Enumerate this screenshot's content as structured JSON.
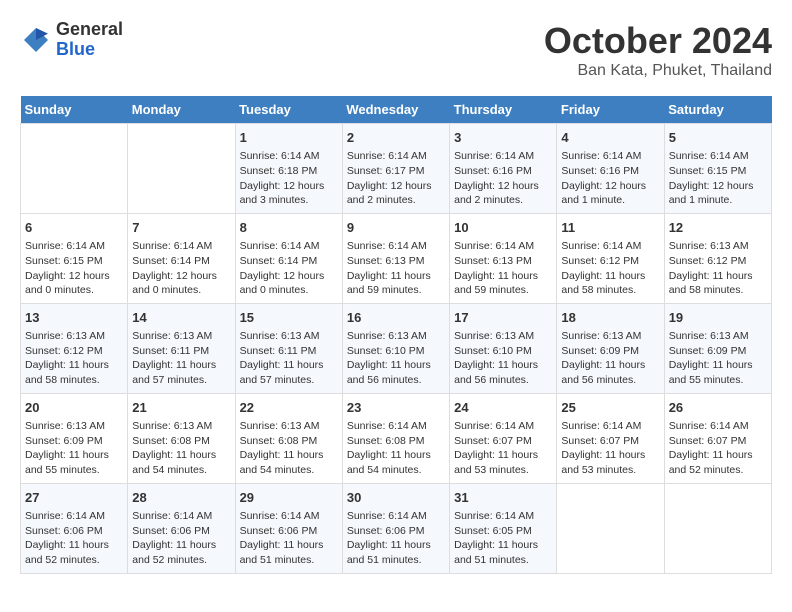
{
  "header": {
    "logo_general": "General",
    "logo_blue": "Blue",
    "title": "October 2024",
    "subtitle": "Ban Kata, Phuket, Thailand"
  },
  "weekdays": [
    "Sunday",
    "Monday",
    "Tuesday",
    "Wednesday",
    "Thursday",
    "Friday",
    "Saturday"
  ],
  "weeks": [
    [
      {
        "day": "",
        "info": ""
      },
      {
        "day": "",
        "info": ""
      },
      {
        "day": "1",
        "info": "Sunrise: 6:14 AM\nSunset: 6:18 PM\nDaylight: 12 hours and 3 minutes."
      },
      {
        "day": "2",
        "info": "Sunrise: 6:14 AM\nSunset: 6:17 PM\nDaylight: 12 hours and 2 minutes."
      },
      {
        "day": "3",
        "info": "Sunrise: 6:14 AM\nSunset: 6:16 PM\nDaylight: 12 hours and 2 minutes."
      },
      {
        "day": "4",
        "info": "Sunrise: 6:14 AM\nSunset: 6:16 PM\nDaylight: 12 hours and 1 minute."
      },
      {
        "day": "5",
        "info": "Sunrise: 6:14 AM\nSunset: 6:15 PM\nDaylight: 12 hours and 1 minute."
      }
    ],
    [
      {
        "day": "6",
        "info": "Sunrise: 6:14 AM\nSunset: 6:15 PM\nDaylight: 12 hours and 0 minutes."
      },
      {
        "day": "7",
        "info": "Sunrise: 6:14 AM\nSunset: 6:14 PM\nDaylight: 12 hours and 0 minutes."
      },
      {
        "day": "8",
        "info": "Sunrise: 6:14 AM\nSunset: 6:14 PM\nDaylight: 12 hours and 0 minutes."
      },
      {
        "day": "9",
        "info": "Sunrise: 6:14 AM\nSunset: 6:13 PM\nDaylight: 11 hours and 59 minutes."
      },
      {
        "day": "10",
        "info": "Sunrise: 6:14 AM\nSunset: 6:13 PM\nDaylight: 11 hours and 59 minutes."
      },
      {
        "day": "11",
        "info": "Sunrise: 6:14 AM\nSunset: 6:12 PM\nDaylight: 11 hours and 58 minutes."
      },
      {
        "day": "12",
        "info": "Sunrise: 6:13 AM\nSunset: 6:12 PM\nDaylight: 11 hours and 58 minutes."
      }
    ],
    [
      {
        "day": "13",
        "info": "Sunrise: 6:13 AM\nSunset: 6:12 PM\nDaylight: 11 hours and 58 minutes."
      },
      {
        "day": "14",
        "info": "Sunrise: 6:13 AM\nSunset: 6:11 PM\nDaylight: 11 hours and 57 minutes."
      },
      {
        "day": "15",
        "info": "Sunrise: 6:13 AM\nSunset: 6:11 PM\nDaylight: 11 hours and 57 minutes."
      },
      {
        "day": "16",
        "info": "Sunrise: 6:13 AM\nSunset: 6:10 PM\nDaylight: 11 hours and 56 minutes."
      },
      {
        "day": "17",
        "info": "Sunrise: 6:13 AM\nSunset: 6:10 PM\nDaylight: 11 hours and 56 minutes."
      },
      {
        "day": "18",
        "info": "Sunrise: 6:13 AM\nSunset: 6:09 PM\nDaylight: 11 hours and 56 minutes."
      },
      {
        "day": "19",
        "info": "Sunrise: 6:13 AM\nSunset: 6:09 PM\nDaylight: 11 hours and 55 minutes."
      }
    ],
    [
      {
        "day": "20",
        "info": "Sunrise: 6:13 AM\nSunset: 6:09 PM\nDaylight: 11 hours and 55 minutes."
      },
      {
        "day": "21",
        "info": "Sunrise: 6:13 AM\nSunset: 6:08 PM\nDaylight: 11 hours and 54 minutes."
      },
      {
        "day": "22",
        "info": "Sunrise: 6:13 AM\nSunset: 6:08 PM\nDaylight: 11 hours and 54 minutes."
      },
      {
        "day": "23",
        "info": "Sunrise: 6:14 AM\nSunset: 6:08 PM\nDaylight: 11 hours and 54 minutes."
      },
      {
        "day": "24",
        "info": "Sunrise: 6:14 AM\nSunset: 6:07 PM\nDaylight: 11 hours and 53 minutes."
      },
      {
        "day": "25",
        "info": "Sunrise: 6:14 AM\nSunset: 6:07 PM\nDaylight: 11 hours and 53 minutes."
      },
      {
        "day": "26",
        "info": "Sunrise: 6:14 AM\nSunset: 6:07 PM\nDaylight: 11 hours and 52 minutes."
      }
    ],
    [
      {
        "day": "27",
        "info": "Sunrise: 6:14 AM\nSunset: 6:06 PM\nDaylight: 11 hours and 52 minutes."
      },
      {
        "day": "28",
        "info": "Sunrise: 6:14 AM\nSunset: 6:06 PM\nDaylight: 11 hours and 52 minutes."
      },
      {
        "day": "29",
        "info": "Sunrise: 6:14 AM\nSunset: 6:06 PM\nDaylight: 11 hours and 51 minutes."
      },
      {
        "day": "30",
        "info": "Sunrise: 6:14 AM\nSunset: 6:06 PM\nDaylight: 11 hours and 51 minutes."
      },
      {
        "day": "31",
        "info": "Sunrise: 6:14 AM\nSunset: 6:05 PM\nDaylight: 11 hours and 51 minutes."
      },
      {
        "day": "",
        "info": ""
      },
      {
        "day": "",
        "info": ""
      }
    ]
  ]
}
